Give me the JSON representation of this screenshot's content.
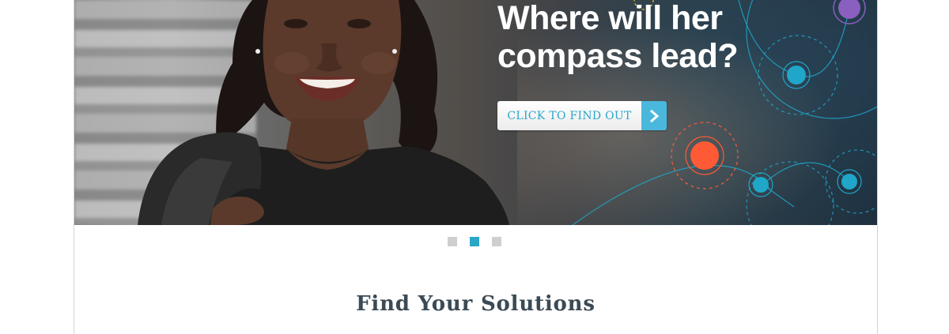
{
  "hero": {
    "headline_line1": "Where will her",
    "headline_line2": "compass lead?",
    "cta_label": "CLICK TO FIND OUT",
    "cta_icon": "chevron-right-icon"
  },
  "carousel": {
    "slide_count": 3,
    "active_index": 1
  },
  "section": {
    "title": "Find Your Solutions"
  },
  "colors": {
    "accent": "#2aa6c8",
    "accent_arrow": "#4ab8dc",
    "orange": "#ff5a36",
    "purple": "#8a5fbf",
    "title_text": "#3b4a54"
  }
}
